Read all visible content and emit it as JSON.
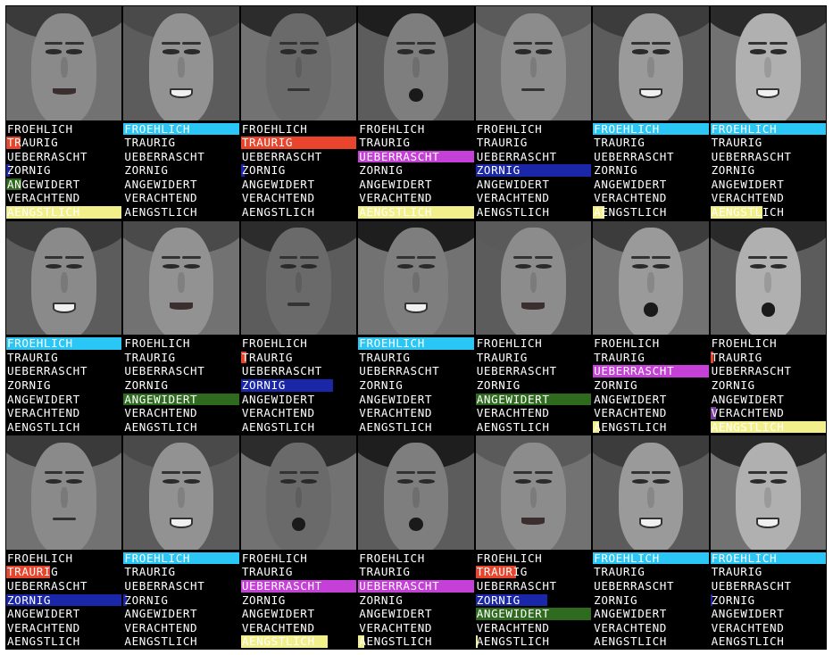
{
  "labels": [
    "FROEHLICH",
    "TRAURIG",
    "UEBERRASCHT",
    "ZORNIG",
    "ANGEWIDERT",
    "VERACHTEND",
    "AENGSTLICH"
  ],
  "label_colors": [
    "#29c6f6",
    "#e8452c",
    "#c540d6",
    "#1a27a8",
    "#2f6b1f",
    "#7b3fa0",
    "#f2f08a"
  ],
  "faces": [
    {
      "expression": "disgusted",
      "scores": [
        0,
        0.12,
        0,
        0.03,
        0.13,
        0,
        1
      ]
    },
    {
      "expression": "happy",
      "scores": [
        1,
        0,
        0,
        0,
        0,
        0,
        0
      ]
    },
    {
      "expression": "sad",
      "scores": [
        0,
        1,
        0,
        0.03,
        0,
        0,
        0
      ]
    },
    {
      "expression": "surprised",
      "scores": [
        0,
        0,
        1,
        0,
        0,
        0,
        1
      ]
    },
    {
      "expression": "angry",
      "scores": [
        0,
        0,
        0,
        1,
        0,
        0,
        0
      ]
    },
    {
      "expression": "happy",
      "scores": [
        1,
        0,
        0,
        0,
        0,
        0,
        0.1
      ]
    },
    {
      "expression": "happy",
      "scores": [
        1,
        0,
        0,
        0,
        0,
        0,
        0.45
      ]
    },
    {
      "expression": "happy",
      "scores": [
        1,
        0,
        0,
        0,
        0,
        0,
        0
      ]
    },
    {
      "expression": "disgusted",
      "scores": [
        0,
        0,
        0,
        0,
        1,
        0,
        0
      ]
    },
    {
      "expression": "angry",
      "scores": [
        0,
        0.05,
        0,
        0.8,
        0,
        0,
        0
      ]
    },
    {
      "expression": "happy",
      "scores": [
        1,
        0,
        0,
        0,
        0,
        0,
        0
      ]
    },
    {
      "expression": "disgusted",
      "scores": [
        0,
        0,
        0,
        0,
        1,
        0,
        0
      ]
    },
    {
      "expression": "surprised",
      "scores": [
        0,
        0,
        1,
        0,
        0,
        0,
        0.05
      ]
    },
    {
      "expression": "surprised",
      "scores": [
        0,
        0.03,
        0,
        0,
        0,
        0.05,
        1
      ]
    },
    {
      "expression": "sad",
      "scores": [
        0,
        0.38,
        0,
        1,
        0,
        0,
        0
      ]
    },
    {
      "expression": "happy",
      "scores": [
        1,
        0,
        0,
        0.03,
        0,
        0,
        0
      ]
    },
    {
      "expression": "surprised",
      "scores": [
        0,
        0,
        1,
        0,
        0,
        0,
        0.75
      ]
    },
    {
      "expression": "surprised",
      "scores": [
        0,
        0,
        1,
        0,
        0,
        0,
        0.05
      ]
    },
    {
      "expression": "disgusted",
      "scores": [
        0,
        0.35,
        0,
        0.62,
        1,
        0,
        0.02
      ]
    },
    {
      "expression": "happy",
      "scores": [
        1,
        0,
        0,
        0,
        0,
        0,
        0
      ]
    },
    {
      "expression": "happy",
      "scores": [
        1,
        0,
        0,
        0.02,
        0,
        0,
        0
      ]
    }
  ]
}
